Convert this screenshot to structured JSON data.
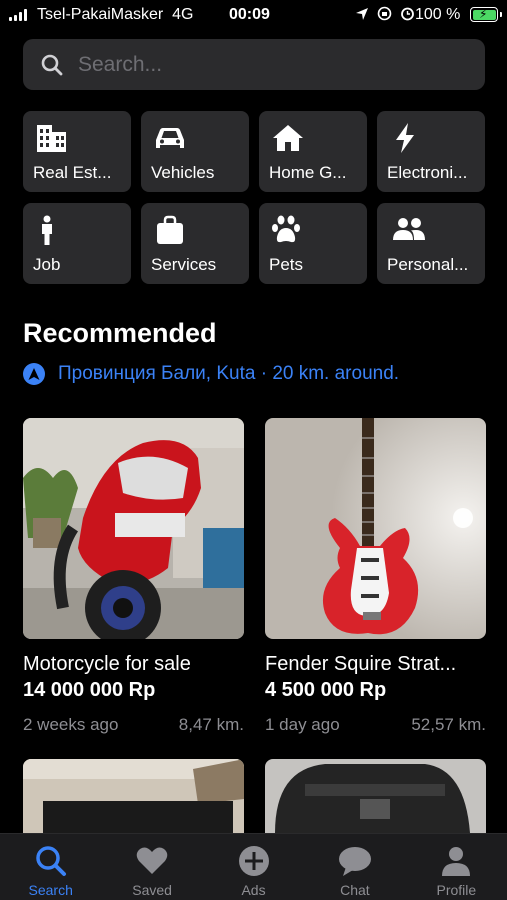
{
  "status_bar": {
    "carrier": "Tsel-PakaiMasker",
    "network": "4G",
    "time": "00:09",
    "battery_percent": "100 %"
  },
  "search": {
    "placeholder": "Search..."
  },
  "categories": [
    {
      "label": "Real Est...",
      "icon": "building-icon"
    },
    {
      "label": "Vehicles",
      "icon": "car-icon"
    },
    {
      "label": "Home G...",
      "icon": "home-icon"
    },
    {
      "label": "Electroni...",
      "icon": "lightning-icon"
    },
    {
      "label": "Job",
      "icon": "person-icon"
    },
    {
      "label": "Services",
      "icon": "bag-icon"
    },
    {
      "label": "Pets",
      "icon": "paw-icon"
    },
    {
      "label": "Personal...",
      "icon": "people-icon"
    }
  ],
  "recommended": {
    "title": "Recommended",
    "location": "Провинция Бали, Kuta · 20 km. around."
  },
  "listings": [
    {
      "title": "Motorcycle for sale",
      "price": "14 000 000 Rp",
      "age": "2 weeks ago",
      "distance": "8,47 km.",
      "image": "red motorcycle"
    },
    {
      "title": "Fender Squire Strat...",
      "price": "4 500 000 Rp",
      "age": "1 day ago",
      "distance": "52,57 km.",
      "image": "red electric guitar"
    }
  ],
  "tabbar": {
    "tabs": [
      {
        "label": "Search",
        "icon": "search-icon",
        "active": true
      },
      {
        "label": "Saved",
        "icon": "heart-icon",
        "active": false
      },
      {
        "label": "Ads",
        "icon": "plus-circle-icon",
        "active": false
      },
      {
        "label": "Chat",
        "icon": "chat-bubble-icon",
        "active": false
      },
      {
        "label": "Profile",
        "icon": "profile-icon",
        "active": false
      }
    ]
  },
  "colors": {
    "accent": "#3b82f6",
    "background": "#000000",
    "tile": "#2b2b2d",
    "battery": "#4cd964"
  }
}
